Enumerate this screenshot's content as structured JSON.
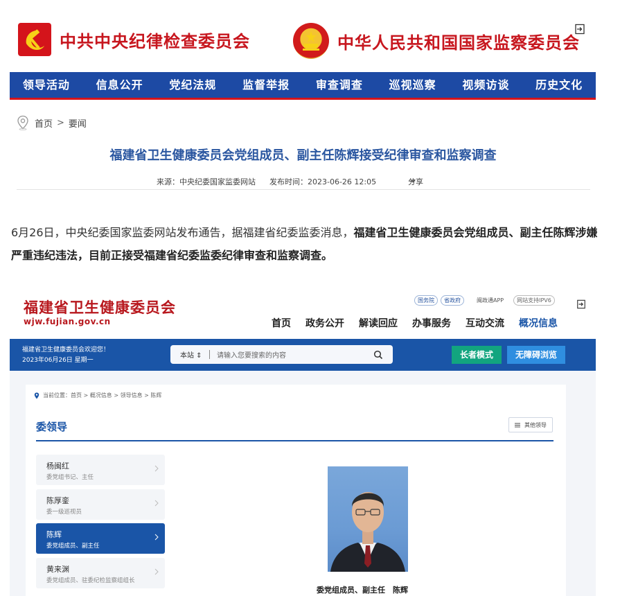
{
  "header": {
    "left_title": "中共中央纪律检查委员会",
    "right_title": "中华人民共和国国家监察委员会"
  },
  "nav": {
    "items": [
      "领导活动",
      "信息公开",
      "党纪法规",
      "监督举报",
      "审查调查",
      "巡视巡察",
      "视频访谈",
      "历史文化"
    ]
  },
  "breadcrumb": {
    "home": "首页",
    "separator": ">",
    "current": "要闻"
  },
  "article": {
    "title": "福建省卫生健康委员会党组成员、副主任陈辉接受纪律审查和监察调查",
    "source": "来源：中央纪委国家监委网站",
    "published": "发布时间：2023-06-26 12:05",
    "share": "分享",
    "paragraph_plain": "6月26日，中央纪委国家监委网站发布通告，据福建省纪委监委消息，",
    "paragraph_bold": "福建省卫生健康委员会党组成员、副主任陈辉涉嫌严重违纪违法，目前正接受福建省纪委监委纪律审查和监察调查。"
  },
  "screenshot": {
    "site_title": "福建省卫生健康委员会",
    "site_url": "wjw.fujian.gov.cn",
    "top_links": {
      "gov1": "国务院",
      "gov2": "省政府",
      "app": "闽政通APP",
      "ipv6": "网站支持IPV6"
    },
    "nav": [
      "首页",
      "政务公开",
      "解读回应",
      "办事服务",
      "互动交流",
      "概况信息"
    ],
    "welcome_line1": "福建省卫生健康委员会欢迎您！",
    "welcome_line2": "2023年06月26日 星期一",
    "search_scope": "本站 ⇕",
    "search_placeholder": "请输入您要搜索的内容",
    "elder_mode": "长者模式",
    "accessible": "无障碍浏览",
    "crumb": "当前位置：首页 > 概况信息 > 领导信息 > 陈辉",
    "section_title": "委领导",
    "other_leaders": "其他领导",
    "leaders": [
      {
        "name": "杨闽红",
        "role": "委党组书记、主任"
      },
      {
        "name": "陈厚銮",
        "role": "委一级巡视员"
      },
      {
        "name": "陈辉",
        "role": "委党组成员、副主任"
      },
      {
        "name": "黄来渊",
        "role": "委党组成员、驻委纪检监察组组长"
      }
    ],
    "caption": "委党组成员、副主任　陈辉"
  },
  "colors": {
    "ccdi_red": "#c7161e",
    "nav_blue": "#1d4aa4",
    "title_blue": "#2a56a0",
    "fujian_blue": "#1a55a7",
    "elder_green": "#12a57f",
    "access_blue": "#2f8ee0"
  },
  "icons": {
    "party_emblem": "hammer-sickle-icon",
    "national_emblem": "national-emblem-icon",
    "login": "login-icon",
    "location": "location-pin-icon",
    "search": "search-icon",
    "chevron": "chevron-right-icon",
    "menu": "list-icon"
  }
}
